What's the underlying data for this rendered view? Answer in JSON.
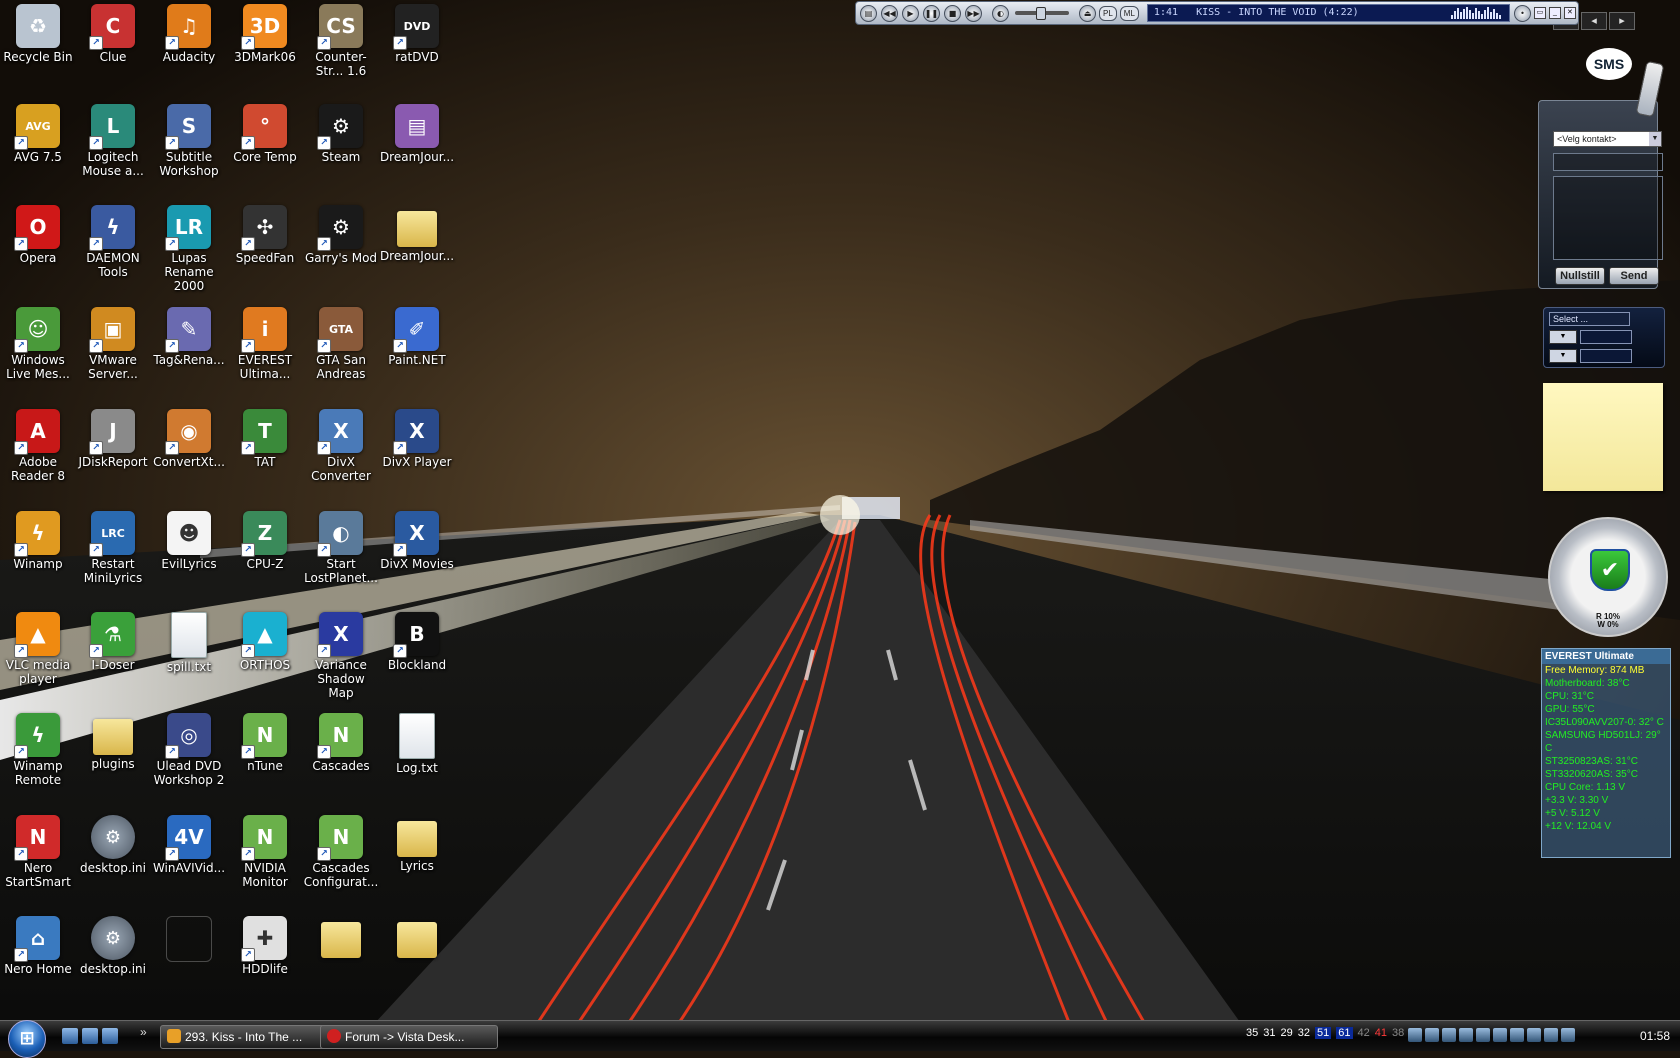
{
  "desktop": {
    "icons": [
      {
        "label": "Recycle Bin",
        "col": 0,
        "row": 0,
        "color": "#b9c4d0",
        "glyph": "♻",
        "kind": "app",
        "shortcut": false
      },
      {
        "label": "Clue",
        "col": 1,
        "row": 0,
        "color": "#c83232",
        "glyph": "C",
        "kind": "app",
        "shortcut": true
      },
      {
        "label": "Audacity",
        "col": 2,
        "row": 0,
        "color": "#e07b1a",
        "glyph": "♫",
        "kind": "app",
        "shortcut": true
      },
      {
        "label": "3DMark06",
        "col": 3,
        "row": 0,
        "color": "#f08a20",
        "glyph": "3D",
        "kind": "app",
        "shortcut": true
      },
      {
        "label": "Counter-Str... 1.6",
        "col": 4,
        "row": 0,
        "color": "#8a7a5a",
        "glyph": "CS",
        "kind": "app",
        "shortcut": true
      },
      {
        "label": "ratDVD",
        "col": 5,
        "row": 0,
        "color": "#222222",
        "glyph": "DVD",
        "kind": "app",
        "shortcut": true
      },
      {
        "label": "AVG 7.5",
        "col": 0,
        "row": 1,
        "color": "#d8a020",
        "glyph": "AVG",
        "kind": "app",
        "shortcut": true
      },
      {
        "label": "Logitech Mouse a...",
        "col": 1,
        "row": 1,
        "color": "#2a8a7a",
        "glyph": "L",
        "kind": "app",
        "shortcut": true
      },
      {
        "label": "Subtitle Workshop",
        "col": 2,
        "row": 1,
        "color": "#4a6aa8",
        "glyph": "S",
        "kind": "app",
        "shortcut": true
      },
      {
        "label": "Core Temp",
        "col": 3,
        "row": 1,
        "color": "#d04a30",
        "glyph": "°",
        "kind": "app",
        "shortcut": true
      },
      {
        "label": "Steam",
        "col": 4,
        "row": 1,
        "color": "#1a1a1a",
        "glyph": "⚙",
        "kind": "app",
        "shortcut": true
      },
      {
        "label": "DreamJour...",
        "col": 5,
        "row": 1,
        "color": "#8a5ab0",
        "glyph": "▤",
        "kind": "app",
        "shortcut": false
      },
      {
        "label": "Opera",
        "col": 0,
        "row": 2,
        "color": "#d01818",
        "glyph": "O",
        "kind": "app",
        "shortcut": true
      },
      {
        "label": "DAEMON Tools",
        "col": 1,
        "row": 2,
        "color": "#3a5aa0",
        "glyph": "ϟ",
        "kind": "app",
        "shortcut": true
      },
      {
        "label": "Lupas Rename 2000",
        "col": 2,
        "row": 2,
        "color": "#1a9ab0",
        "glyph": "LR",
        "kind": "app",
        "shortcut": true
      },
      {
        "label": "SpeedFan",
        "col": 3,
        "row": 2,
        "color": "#333333",
        "glyph": "✣",
        "kind": "app",
        "shortcut": true
      },
      {
        "label": "Garry's Mod",
        "col": 4,
        "row": 2,
        "color": "#1a1a1a",
        "glyph": "⚙",
        "kind": "app",
        "shortcut": true
      },
      {
        "label": "DreamJour...",
        "col": 5,
        "row": 2,
        "color": "#e0c060",
        "glyph": "",
        "kind": "folder",
        "shortcut": false
      },
      {
        "label": "Windows Live Mes...",
        "col": 0,
        "row": 3,
        "color": "#4a9a3a",
        "glyph": "☺",
        "kind": "app",
        "shortcut": true
      },
      {
        "label": "VMware Server...",
        "col": 1,
        "row": 3,
        "color": "#d08a20",
        "glyph": "▣",
        "kind": "app",
        "shortcut": true
      },
      {
        "label": "Tag&Rena...",
        "col": 2,
        "row": 3,
        "color": "#6a6ab0",
        "glyph": "✎",
        "kind": "app",
        "shortcut": true
      },
      {
        "label": "EVEREST Ultima...",
        "col": 3,
        "row": 3,
        "color": "#e07a20",
        "glyph": "i",
        "kind": "app",
        "shortcut": true
      },
      {
        "label": "GTA San Andreas",
        "col": 4,
        "row": 3,
        "color": "#8a5a3a",
        "glyph": "GTA",
        "kind": "app",
        "shortcut": true
      },
      {
        "label": "Paint.NET",
        "col": 5,
        "row": 3,
        "color": "#3a6ad0",
        "glyph": "✐",
        "kind": "app",
        "shortcut": true
      },
      {
        "label": "Adobe Reader 8",
        "col": 0,
        "row": 4,
        "color": "#c81818",
        "glyph": "A",
        "kind": "app",
        "shortcut": true
      },
      {
        "label": "JDiskReport",
        "col": 1,
        "row": 4,
        "color": "#8a8a8a",
        "glyph": "J",
        "kind": "app",
        "shortcut": true
      },
      {
        "label": "ConvertXt...",
        "col": 2,
        "row": 4,
        "color": "#d07a30",
        "glyph": "◉",
        "kind": "app",
        "shortcut": true
      },
      {
        "label": "TAT",
        "col": 3,
        "row": 4,
        "color": "#3a8a3a",
        "glyph": "T",
        "kind": "app",
        "shortcut": true
      },
      {
        "label": "DivX Converter",
        "col": 4,
        "row": 4,
        "color": "#4a7ab8",
        "glyph": "X",
        "kind": "app",
        "shortcut": true
      },
      {
        "label": "DivX Player",
        "col": 5,
        "row": 4,
        "color": "#2a4a8a",
        "glyph": "X",
        "kind": "app",
        "shortcut": true
      },
      {
        "label": "Winamp",
        "col": 0,
        "row": 5,
        "color": "#e09a20",
        "glyph": "ϟ",
        "kind": "app",
        "shortcut": true
      },
      {
        "label": "Restart MiniLyrics",
        "col": 1,
        "row": 5,
        "color": "#2a6ab0",
        "glyph": "LRC",
        "kind": "app",
        "shortcut": true
      },
      {
        "label": "EvilLyrics",
        "col": 2,
        "row": 5,
        "color": "#f4f4f4",
        "glyph": "☻",
        "kind": "app",
        "shortcut": false
      },
      {
        "label": "CPU-Z",
        "col": 3,
        "row": 5,
        "color": "#3a8a5a",
        "glyph": "Z",
        "kind": "app",
        "shortcut": true
      },
      {
        "label": "Start LostPlanet...",
        "col": 4,
        "row": 5,
        "color": "#5a7a9a",
        "glyph": "◐",
        "kind": "app",
        "shortcut": true
      },
      {
        "label": "DivX Movies",
        "col": 5,
        "row": 5,
        "color": "#2a5aa0",
        "glyph": "X",
        "kind": "app",
        "shortcut": true
      },
      {
        "label": "VLC media player",
        "col": 0,
        "row": 6,
        "color": "#f08a10",
        "glyph": "▲",
        "kind": "app",
        "shortcut": true
      },
      {
        "label": "I-Doser",
        "col": 1,
        "row": 6,
        "color": "#3aa03a",
        "glyph": "⚗",
        "kind": "app",
        "shortcut": true
      },
      {
        "label": "spill.txt",
        "col": 2,
        "row": 6,
        "color": "#ffffff",
        "glyph": "",
        "kind": "file",
        "shortcut": false
      },
      {
        "label": "ORTHOS",
        "col": 3,
        "row": 6,
        "color": "#1ab0d0",
        "glyph": "▲",
        "kind": "app",
        "shortcut": true
      },
      {
        "label": "Variance Shadow Map",
        "col": 4,
        "row": 6,
        "color": "#2a3aa0",
        "glyph": "X",
        "kind": "app",
        "shortcut": true
      },
      {
        "label": "Blockland",
        "col": 5,
        "row": 6,
        "color": "#111111",
        "glyph": "B",
        "kind": "app",
        "shortcut": true
      },
      {
        "label": "Winamp Remote",
        "col": 0,
        "row": 7,
        "color": "#3a9a3a",
        "glyph": "ϟ",
        "kind": "app",
        "shortcut": true
      },
      {
        "label": "plugins",
        "col": 1,
        "row": 7,
        "color": "#e0c060",
        "glyph": "",
        "kind": "folder",
        "shortcut": false
      },
      {
        "label": "Ulead DVD Workshop 2",
        "col": 2,
        "row": 7,
        "color": "#3a4a8a",
        "glyph": "◎",
        "kind": "app",
        "shortcut": true
      },
      {
        "label": "nTune",
        "col": 3,
        "row": 7,
        "color": "#6ab04a",
        "glyph": "N",
        "kind": "app",
        "shortcut": true
      },
      {
        "label": "Cascades",
        "col": 4,
        "row": 7,
        "color": "#6ab04a",
        "glyph": "N",
        "kind": "app",
        "shortcut": true
      },
      {
        "label": "Log.txt",
        "col": 5,
        "row": 7,
        "color": "#ffffff",
        "glyph": "",
        "kind": "file",
        "shortcut": false
      },
      {
        "label": "Nero StartSmart",
        "col": 0,
        "row": 8,
        "color": "#d02a2a",
        "glyph": "N",
        "kind": "app",
        "shortcut": true
      },
      {
        "label": "desktop.ini",
        "col": 1,
        "row": 8,
        "color": "#7a8594",
        "glyph": "⚙",
        "kind": "gear",
        "shortcut": false
      },
      {
        "label": "WinAVIVid...",
        "col": 2,
        "row": 8,
        "color": "#2a6ac0",
        "glyph": "4V",
        "kind": "app",
        "shortcut": true
      },
      {
        "label": "NVIDIA Monitor",
        "col": 3,
        "row": 8,
        "color": "#6ab04a",
        "glyph": "N",
        "kind": "app",
        "shortcut": true
      },
      {
        "label": "Cascades Configurat...",
        "col": 4,
        "row": 8,
        "color": "#6ab04a",
        "glyph": "N",
        "kind": "app",
        "shortcut": true
      },
      {
        "label": "Lyrics",
        "col": 5,
        "row": 8,
        "color": "#e0c060",
        "glyph": "",
        "kind": "folder",
        "shortcut": false
      },
      {
        "label": "Nero Home",
        "col": 0,
        "row": 9,
        "color": "#3a7ac0",
        "glyph": "⌂",
        "kind": "app",
        "shortcut": true
      },
      {
        "label": "desktop.ini",
        "col": 1,
        "row": 9,
        "color": "#7a8594",
        "glyph": "⚙",
        "kind": "gear",
        "shortcut": false
      },
      {
        "label": "",
        "col": 2,
        "row": 9,
        "color": "#000000",
        "glyph": "",
        "kind": "empty",
        "shortcut": false
      },
      {
        "label": "HDDlife",
        "col": 3,
        "row": 9,
        "color": "#e0e0e0",
        "glyph": "✚",
        "kind": "app",
        "shortcut": true
      },
      {
        "label": "",
        "col": 4,
        "row": 9,
        "color": "#e0c060",
        "glyph": "",
        "kind": "folder",
        "shortcut": false
      },
      {
        "label": "",
        "col": 5,
        "row": 9,
        "color": "#e0c060",
        "glyph": "",
        "kind": "folder",
        "shortcut": false
      }
    ]
  },
  "media_player": {
    "track_time": "1:41",
    "track_title": "KISS - INTO THE VOID (4:22)",
    "volume_fraction": 0.45,
    "pl_label": "PL",
    "ml_label": "ML"
  },
  "sidebar": {
    "sms": {
      "bubble": "SMS",
      "contact_placeholder": "<Velg kontakt>",
      "reset_label": "Nullstill",
      "send_label": "Send"
    },
    "converter": {
      "select_label": "Select ..."
    },
    "security": {
      "read_text": "R 10%",
      "write_text": "W 0%"
    },
    "everest": {
      "title": "EVEREST Ultimate",
      "lines": [
        "Free Memory: 874 MB",
        "Motherboard: 38°C",
        "CPU: 31°C",
        "GPU: 55°C",
        "IC35L090AVV207-0: 32° C",
        "SAMSUNG HD501LJ: 29° C",
        "ST3250823AS: 31°C",
        "ST3320620AS: 35°C",
        "CPU Core: 1.13 V",
        "+3.3 V: 3.30 V",
        "+5 V: 5.12 V",
        "+12 V: 12.04 V"
      ]
    }
  },
  "taskbar": {
    "tasks": [
      {
        "label": "293. Kiss - Into The ..."
      },
      {
        "label": "Forum -> Vista Desk..."
      }
    ],
    "quick_launch_more": "»",
    "tray_temps": [
      {
        "v": "35",
        "style": ""
      },
      {
        "v": "31",
        "style": ""
      },
      {
        "v": "29",
        "style": ""
      },
      {
        "v": "32",
        "style": ""
      },
      {
        "v": "51",
        "style": "hi"
      },
      {
        "v": "61",
        "style": "hi"
      },
      {
        "v": "42",
        "style": "gray"
      },
      {
        "v": "41",
        "style": "red"
      },
      {
        "v": "38",
        "style": "gray"
      }
    ],
    "clock": "01:58"
  },
  "colors": {
    "accent": "#1b5fb6",
    "everest_text": "#22ee22",
    "note_yellow": "#fff8c0"
  }
}
